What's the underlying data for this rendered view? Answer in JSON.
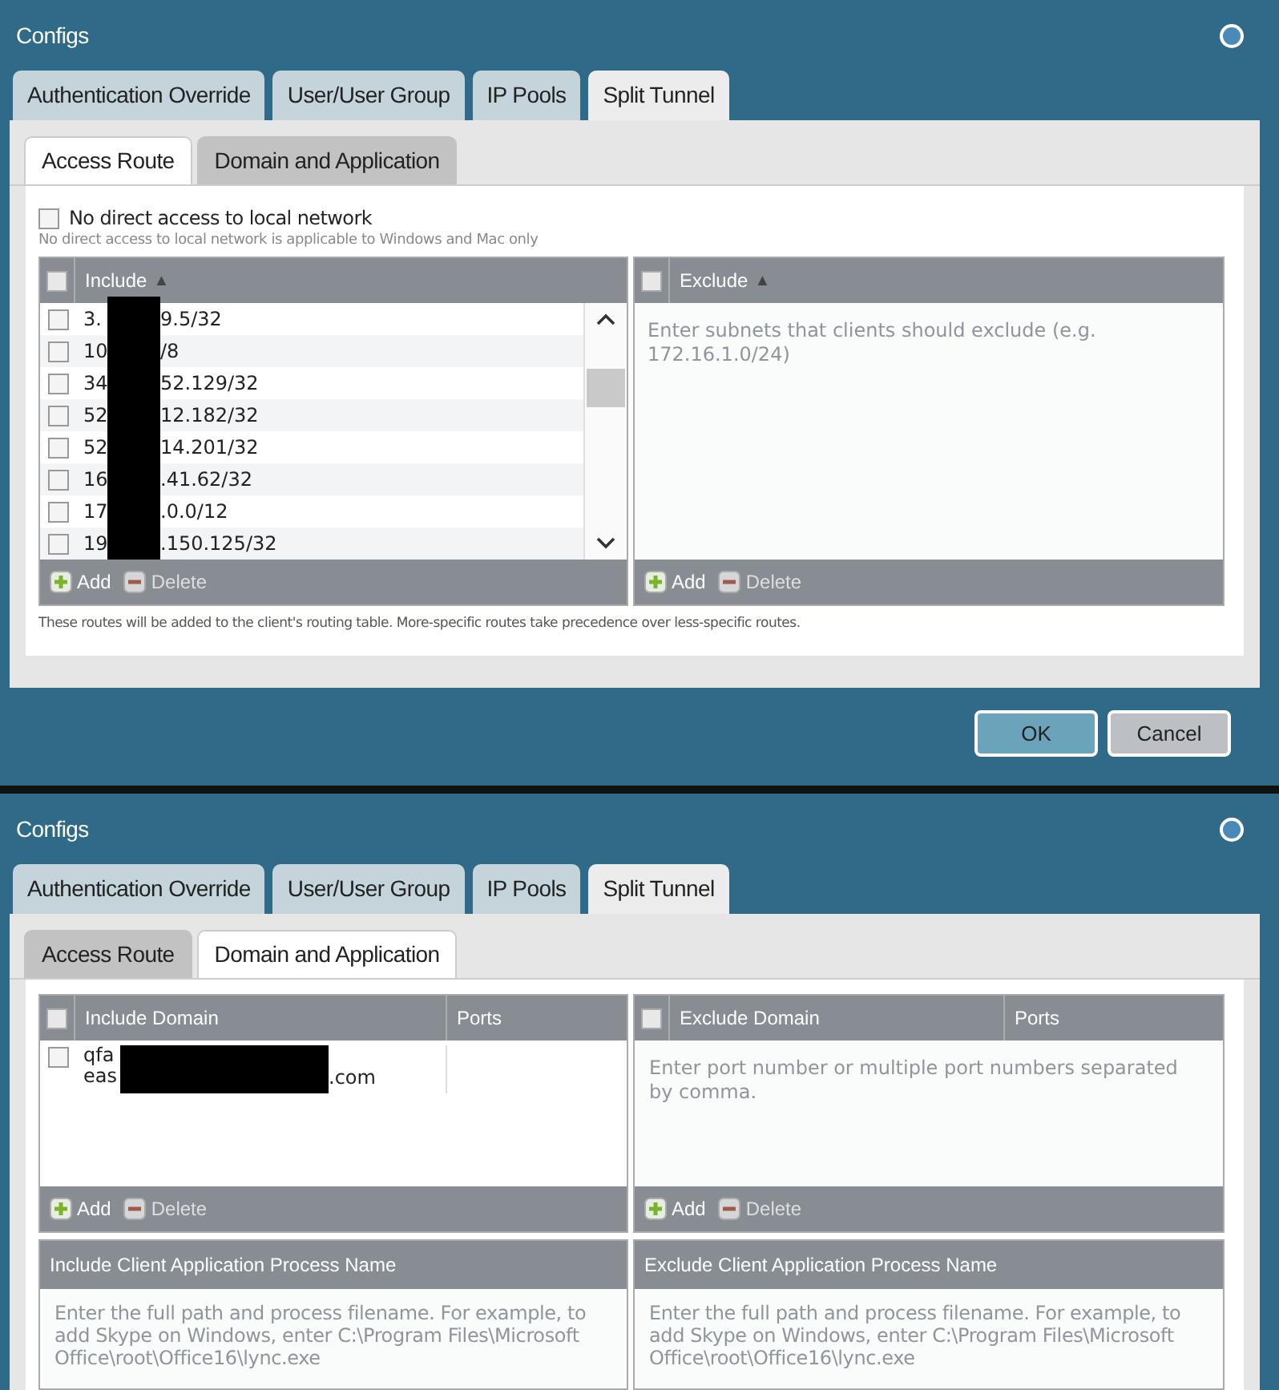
{
  "dialogs": [
    {
      "title": "Configs",
      "tabs": [
        {
          "label": "Authentication Override",
          "selected": false
        },
        {
          "label": "User/User Group",
          "selected": false
        },
        {
          "label": "IP Pools",
          "selected": false
        },
        {
          "label": "Split Tunnel",
          "selected": true
        }
      ],
      "subtabs": [
        {
          "label": "Access Route",
          "selected": true
        },
        {
          "label": "Domain and Application",
          "selected": false
        }
      ],
      "kind": "access_route",
      "no_direct_access": {
        "label": "No direct access to local network",
        "checked": false,
        "hint": "No direct access to local network is applicable to Windows and Mac only"
      },
      "include": {
        "header": "Include",
        "sort": "▲",
        "all_checked": false,
        "rows": [
          {
            "start": "3.",
            "end": "9.5/32",
            "checked": false
          },
          {
            "start": "10",
            "end": "/8",
            "checked": false
          },
          {
            "start": "34",
            "end": "52.129/32",
            "checked": false
          },
          {
            "start": "52",
            "end": "12.182/32",
            "checked": false
          },
          {
            "start": "52",
            "end": "14.201/32",
            "checked": false
          },
          {
            "start": "16",
            "end": ".41.62/32",
            "checked": false
          },
          {
            "start": "17",
            "end": ".0.0/12",
            "checked": false
          },
          {
            "start": "19",
            "end": ".150.125/32",
            "checked": false
          }
        ],
        "add": "Add",
        "delete": "Delete"
      },
      "exclude": {
        "header": "Exclude",
        "sort": "▲",
        "all_checked": false,
        "placeholder": "Enter subnets that clients should exclude (e.g. 172.16.1.0/24)",
        "add": "Add",
        "delete": "Delete"
      },
      "note": "These routes will be added to the client's routing table. More-specific routes take precedence over less-specific routes.",
      "buttons": [
        "OK",
        "Cancel"
      ]
    },
    {
      "title": "Configs",
      "tabs": [
        {
          "label": "Authentication Override",
          "selected": false
        },
        {
          "label": "User/User Group",
          "selected": false
        },
        {
          "label": "IP Pools",
          "selected": false
        },
        {
          "label": "Split Tunnel",
          "selected": true
        }
      ],
      "subtabs": [
        {
          "label": "Access Route",
          "selected": false
        },
        {
          "label": "Domain and Application",
          "selected": true
        }
      ],
      "kind": "domain",
      "include_domain": {
        "header": "Include Domain",
        "ports": "Ports",
        "all_checked": false,
        "rows": [
          {
            "line1": "qfa",
            "line2": "eas",
            "end": ".com",
            "checked": false
          }
        ],
        "add": "Add",
        "delete": "Delete"
      },
      "exclude_domain": {
        "header": "Exclude Domain",
        "ports": "Ports",
        "all_checked": false,
        "placeholder": "Enter port number or multiple port numbers separated by comma.",
        "add": "Add",
        "delete": "Delete"
      },
      "include_app": {
        "header": "Include Client Application Process Name",
        "placeholder": "Enter the full path and process filename. For example, to add Skype on Windows, enter C:\\Program Files\\Microsoft Office\\root\\Office16\\lync.exe"
      },
      "exclude_app": {
        "header": "Exclude Client Application Process Name",
        "placeholder": "Enter the full path and process filename. For example, to add Skype on Windows, enter C:\\Program Files\\Microsoft Office\\root\\Office16\\lync.exe"
      }
    }
  ]
}
